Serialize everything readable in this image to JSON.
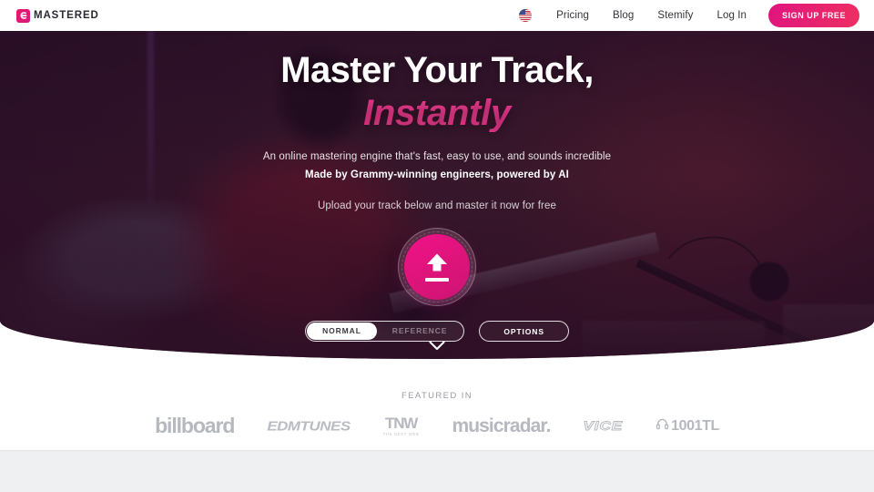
{
  "brand": {
    "name": "MASTERED",
    "mark_icon": "emastered-logo-icon"
  },
  "nav": {
    "locale_icon": "us-flag-icon",
    "links": [
      {
        "label": "Pricing"
      },
      {
        "label": "Blog"
      },
      {
        "label": "Stemify"
      },
      {
        "label": "Log In"
      }
    ],
    "cta": {
      "label": "SIGN UP FREE"
    }
  },
  "hero": {
    "title_line1": "Master Your Track,",
    "title_line2": "Instantly",
    "subtitle1": "An online mastering engine that's fast, easy to use, and sounds incredible",
    "subtitle2": "Made by Grammy-winning engineers, powered by AI",
    "subtitle3": "Upload your track below and master it now for free",
    "upload": {
      "icon": "upload-arrow-icon",
      "aria_label": "Upload your track"
    },
    "mode_toggle": {
      "options": [
        {
          "label": "NORMAL",
          "active": true
        },
        {
          "label": "REFERENCE",
          "active": false
        }
      ]
    },
    "options_button": {
      "label": "OPTIONS"
    },
    "scroll_indicator_icon": "chevron-down-icon",
    "accent_color": "#e0157e",
    "accent_color_2": "#ed2f62",
    "background_tint": "#3a1b2c"
  },
  "featured": {
    "label": "FEATURED IN",
    "logos": [
      {
        "name": "billboard",
        "text": "billboard"
      },
      {
        "name": "edmtunes",
        "text": "EDMTUNES"
      },
      {
        "name": "tnw",
        "text": "TNW",
        "tagline": "THE NEXT WEB"
      },
      {
        "name": "musicradar",
        "text": "musicradar."
      },
      {
        "name": "vice",
        "text": "VICE"
      },
      {
        "name": "1001tracklists",
        "text": "1001TL",
        "icon": "headphones-icon"
      }
    ]
  }
}
